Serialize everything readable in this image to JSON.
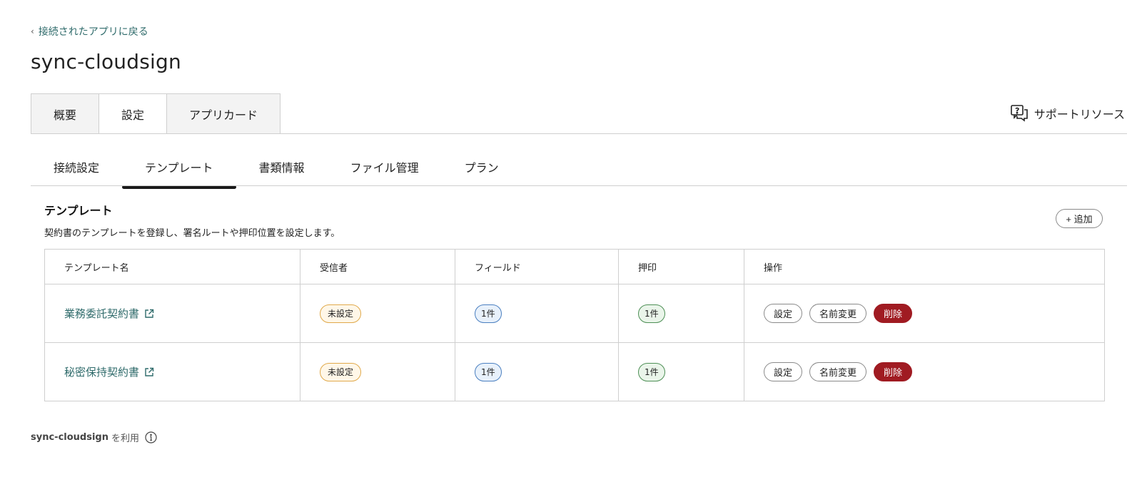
{
  "nav": {
    "back_label": "接続されたアプリに戻る"
  },
  "page": {
    "title": "sync-cloudsign"
  },
  "main_tabs": [
    {
      "label": "概要",
      "active": false
    },
    {
      "label": "設定",
      "active": true
    },
    {
      "label": "アプリカード",
      "active": false
    }
  ],
  "support": {
    "label": "サポートリソース",
    "icon": "chat-question-icon"
  },
  "sub_tabs": [
    {
      "label": "接続設定",
      "active": false
    },
    {
      "label": "テンプレート",
      "active": true
    },
    {
      "label": "書類情報",
      "active": false
    },
    {
      "label": "ファイル管理",
      "active": false
    },
    {
      "label": "プラン",
      "active": false
    }
  ],
  "section": {
    "title": "テンプレート",
    "description": "契約書のテンプレートを登録し、署名ルートや押印位置を設定します。",
    "add_label": "+ 追加"
  },
  "table": {
    "headers": [
      "テンプレート名",
      "受信者",
      "フィールド",
      "押印",
      "操作"
    ],
    "rows": [
      {
        "name": "業務委託契約書",
        "recipient": "未設定",
        "fields": "1件",
        "stamp": "1件",
        "actions": [
          "設定",
          "名前変更",
          "削除"
        ]
      },
      {
        "name": "秘密保持契約書",
        "recipient": "未設定",
        "fields": "1件",
        "stamp": "1件",
        "actions": [
          "設定",
          "名前変更",
          "削除"
        ]
      }
    ]
  },
  "footer": {
    "app_name": "sync-cloudsign",
    "suffix": "を利用",
    "icon": "info-icon"
  },
  "colors": {
    "link": "#2f6b6b",
    "danger": "#a01b22",
    "warn_border": "#e0a94a",
    "blue_border": "#4a7fc0",
    "green_border": "#4d8f55"
  }
}
